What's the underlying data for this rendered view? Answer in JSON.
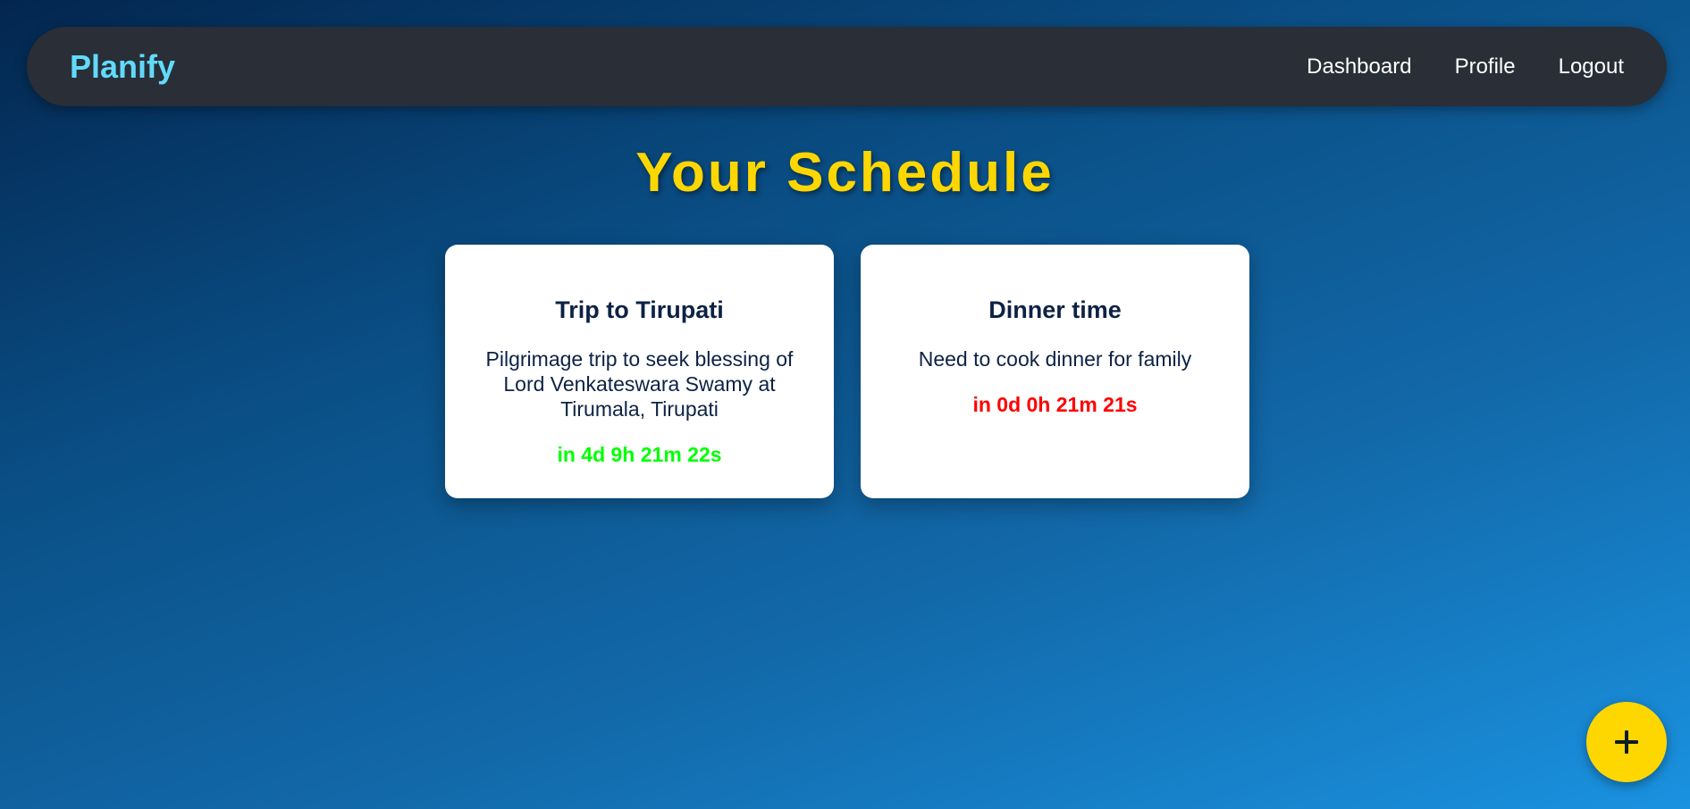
{
  "navbar": {
    "brand": "Planify",
    "links": [
      {
        "label": "Dashboard"
      },
      {
        "label": "Profile"
      },
      {
        "label": "Logout"
      }
    ]
  },
  "page": {
    "title": "Your Schedule"
  },
  "events": [
    {
      "title": "Trip to Tirupati",
      "description": "Pilgrimage trip to seek blessing of Lord Venkateswara Swamy at Tirumala, Tirupati",
      "countdown": "in 4d 9h 21m 22s",
      "countdown_color": "#00ff00"
    },
    {
      "title": "Dinner time",
      "description": "Need to cook dinner for family",
      "countdown": "in 0d 0h 21m 21s",
      "countdown_color": "#ff0000"
    }
  ],
  "fab": {
    "icon": "plus-icon"
  },
  "colors": {
    "brand": "#61dafb",
    "title": "#ffd700",
    "navbar_bg": "#292e37",
    "fab_bg": "#ffd700"
  }
}
